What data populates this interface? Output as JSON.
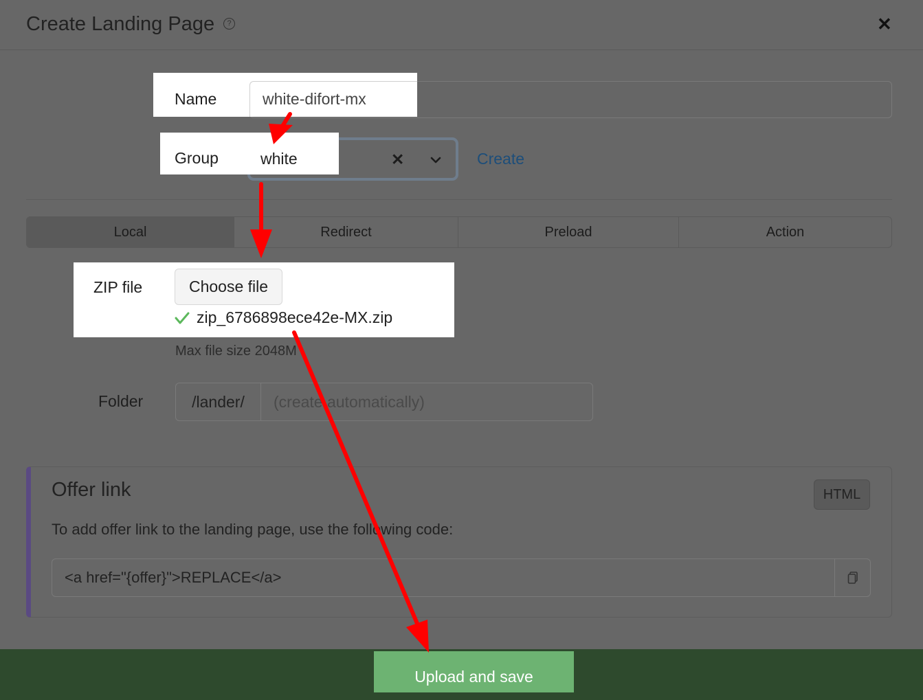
{
  "dialog": {
    "title": "Create Landing Page",
    "help_icon": "question-circle-icon",
    "help_glyph": "?",
    "close_glyph": "✕"
  },
  "form": {
    "name_label": "Name",
    "name_value": "white-difort-mx",
    "group_label": "Group",
    "group_value": "white",
    "group_clear_glyph": "✕",
    "group_create_label": "Create",
    "tabs": [
      {
        "label": "Local",
        "active": true
      },
      {
        "label": "Redirect",
        "active": false
      },
      {
        "label": "Preload",
        "active": false
      },
      {
        "label": "Action",
        "active": false
      }
    ],
    "zip_label": "ZIP file",
    "choose_file_label": "Choose file",
    "zip_filename": "zip_6786898ece42e-MX.zip",
    "max_size_text": "Max file size 2048M",
    "folder_label": "Folder",
    "folder_prefix": "/lander/",
    "folder_placeholder": "(create automatically)"
  },
  "offer_link": {
    "title": "Offer link",
    "html_button_label": "HTML",
    "description": "To add offer link to the landing page, use the following code:",
    "code_value": "<a href=\"{offer}\">REPLACE</a>"
  },
  "footer": {
    "upload_label": "Upload and save"
  },
  "colors": {
    "overlay_background": "#676767",
    "annotation_arrow": "#ff0000",
    "upload_button": "#6db372",
    "footer_background": "#2e4a2d",
    "link": "#1d4e7a",
    "offer_accent": "#5a4a82"
  }
}
